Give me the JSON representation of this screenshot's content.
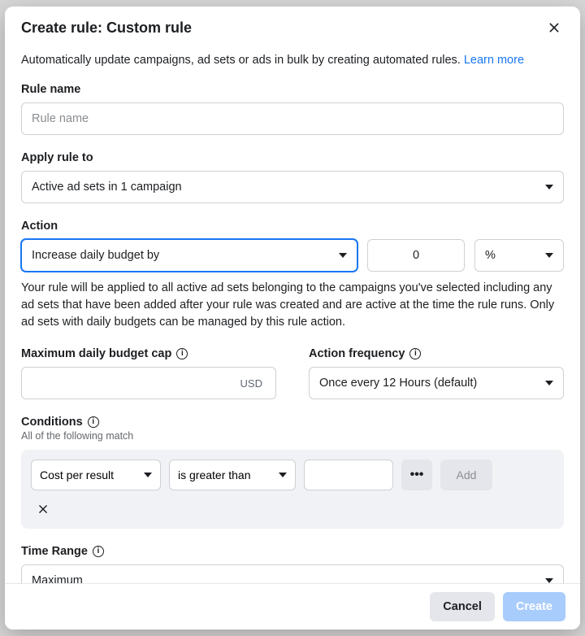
{
  "header": {
    "title": "Create rule: Custom rule"
  },
  "intro": {
    "text": "Automatically update campaigns, ad sets or ads in bulk by creating automated rules.",
    "learn_more": "Learn more"
  },
  "rule_name": {
    "label": "Rule name",
    "placeholder": "Rule name",
    "value": ""
  },
  "apply_to": {
    "label": "Apply rule to",
    "value": "Active ad sets in 1 campaign"
  },
  "action": {
    "label": "Action",
    "value": "Increase daily budget by",
    "amount_value": "0",
    "unit_value": "%",
    "help": "Your rule will be applied to all active ad sets belonging to the campaigns you've selected including any ad sets that have been added after your rule was created and are active at the time the rule runs. Only ad sets with daily budgets can be managed by this rule action."
  },
  "budget_cap": {
    "label": "Maximum daily budget cap",
    "currency": "USD",
    "value": ""
  },
  "frequency": {
    "label": "Action frequency",
    "value": "Once every 12 Hours (default)"
  },
  "conditions": {
    "label": "Conditions",
    "sub": "All of the following match",
    "metric": "Cost per result",
    "operator": "is greater than",
    "value": "",
    "add_label": "Add"
  },
  "time_range": {
    "label": "Time Range",
    "value": "Maximum"
  },
  "footer": {
    "cancel": "Cancel",
    "create": "Create"
  },
  "icons": {
    "close": "close-icon",
    "caret": "caret-down-icon",
    "info": "info-icon",
    "dots": "more-dots-icon",
    "x": "x-icon"
  }
}
